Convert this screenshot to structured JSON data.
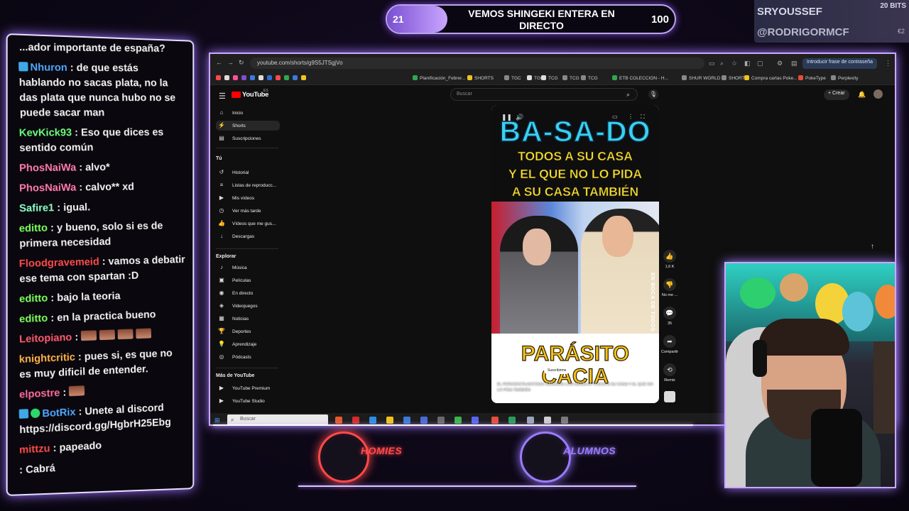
{
  "goal": {
    "start": "21",
    "title": "VEMOS SHINGEKI ENTERA EN DIRECTO",
    "end": "100",
    "progress": 0.21
  },
  "sub_alert": {
    "name": "SRYOUSSEF",
    "bits": "20 BITS",
    "name2": "@RODRIGORMCF",
    "extra": "€2"
  },
  "chat": [
    {
      "user": "",
      "color": "#f1f1f1",
      "text": "...ador importante de españa?",
      "badge": ""
    },
    {
      "user": "Nhuron",
      "color": "#4fa8ff",
      "text": ": de que estás hablando no sacas plata, no la das plata que nunca hubo no se puede sacar man",
      "badge": "blue"
    },
    {
      "user": "KevKick93",
      "color": "#6bff7a",
      "text": ": Eso que dices es sentido común",
      "badge": ""
    },
    {
      "user": "PhosNaiWa",
      "color": "#ff7ab0",
      "text": ": alvo*",
      "badge": ""
    },
    {
      "user": "PhosNaiWa",
      "color": "#ff7ab0",
      "text": ": calvo** xd",
      "badge": ""
    },
    {
      "user": "Safire1",
      "color": "#8fffc6",
      "text": ": igual.",
      "badge": ""
    },
    {
      "user": "editto",
      "color": "#7dff5a",
      "text": ": y bueno, solo si es de primera necesidad",
      "badge": ""
    },
    {
      "user": "Floodgravemeid",
      "color": "#ff4a4a",
      "text": ": vamos a debatir ese tema con spartan :D",
      "badge": ""
    },
    {
      "user": "editto",
      "color": "#7dff5a",
      "text": ": bajo la teoria",
      "badge": ""
    },
    {
      "user": "editto",
      "color": "#7dff5a",
      "text": ": en la practica bueno",
      "badge": ""
    },
    {
      "user": "Leitopiano",
      "color": "#ff5a6e",
      "text": ":",
      "badge": "",
      "emotes": 4
    },
    {
      "user": "knightcritic",
      "color": "#ffb347",
      "text": ": pues si, es que no es muy dificil de entender.",
      "badge": ""
    },
    {
      "user": "elpostre",
      "color": "#ff6b9a",
      "text": ":",
      "badge": "",
      "emotes": 1
    },
    {
      "user": "BotRix",
      "color": "#4fa8ff",
      "text": ": Unete al discord https://discord.gg/HgbrH25Ebg",
      "badge": "blue-green"
    },
    {
      "user": "mittzu",
      "color": "#ff4a4a",
      "text": ": papeado",
      "badge": ""
    },
    {
      "user": "",
      "color": "#f1f1f1",
      "text": ": Cabrá",
      "badge": ""
    }
  ],
  "browser": {
    "url": "youtube.com/shorts/g9S5JTSgjVo",
    "password_hint": "Introducir frase de contraseña",
    "bookmarks": [
      {
        "label": "Planificación_Febrer...",
        "color": "#2fa84f"
      },
      {
        "label": "SHORTS",
        "color": "#f2c31c"
      },
      {
        "label": "TGC",
        "color": "#888888"
      },
      {
        "label": "TGC",
        "color": "#dddddd"
      },
      {
        "label": "TCG",
        "color": "#dddddd"
      },
      {
        "label": "TCG",
        "color": "#888888"
      },
      {
        "label": "TCG",
        "color": "#888888"
      },
      {
        "label": "ETB COLECCION - H...",
        "color": "#2fa84f"
      },
      {
        "label": "SHUR WORLD",
        "color": "#888888"
      },
      {
        "label": "SHORTS",
        "color": "#888888"
      },
      {
        "label": "Compra cartas Poke...",
        "color": "#f2c31c"
      },
      {
        "label": "PokeType",
        "color": "#e74c3c"
      },
      {
        "label": "Perplexity",
        "color": "#888888"
      }
    ]
  },
  "youtube": {
    "logo": "YouTube",
    "logo_cc": "ES",
    "search_placeholder": "Buscar",
    "create_label": "Crear",
    "sidebar_main": [
      {
        "icon": "⌂",
        "label": "Inicio",
        "active": false
      },
      {
        "icon": "⚡",
        "label": "Shorts",
        "active": true
      },
      {
        "icon": "▤",
        "label": "Suscripciones",
        "active": false
      }
    ],
    "you_heading": "Tú",
    "sidebar_you": [
      {
        "icon": "↺",
        "label": "Historial"
      },
      {
        "icon": "≡",
        "label": "Listas de reproducc..."
      },
      {
        "icon": "▶",
        "label": "Mis vídeos"
      },
      {
        "icon": "◷",
        "label": "Ver más tarde"
      },
      {
        "icon": "👍",
        "label": "Vídeos que me gus..."
      },
      {
        "icon": "↓",
        "label": "Descargas"
      }
    ],
    "explore_heading": "Explorar",
    "sidebar_explore": [
      {
        "icon": "♪",
        "label": "Música"
      },
      {
        "icon": "▣",
        "label": "Películas"
      },
      {
        "icon": "◉",
        "label": "En directo"
      },
      {
        "icon": "◈",
        "label": "Videojuegos"
      },
      {
        "icon": "▦",
        "label": "Noticias"
      },
      {
        "icon": "🏆",
        "label": "Deportes"
      },
      {
        "icon": "💡",
        "label": "Aprendizaje"
      },
      {
        "icon": "◎",
        "label": "Pódcasts"
      }
    ],
    "more_heading": "Más de YouTube",
    "sidebar_more": [
      {
        "icon": "▶",
        "label": "YouTube Premium"
      },
      {
        "icon": "▶",
        "label": "YouTube Studio"
      }
    ]
  },
  "short": {
    "headline": "BA-SA-DO",
    "subline1": "TODOS A SU CASA",
    "subline2": "Y EL QUE NO LO PIDA",
    "subline3": "A SU CASA TAMBIÉN",
    "scene_caption": "EN BOCA DE TODOS",
    "tag1": "PARÁSITO",
    "tag2": "CACIA",
    "channel": "@periodistas",
    "subscribe": "Suscribirme",
    "description": "EL PERIODISTA ANTONIO NARANJO LOS MANDA A TODOS A SU CASA Y AL QUE NO LO PIDA TAMBIÉN",
    "actions": [
      {
        "icon": "👍",
        "label": "1,6 K"
      },
      {
        "icon": "👎",
        "label": "No me ..."
      },
      {
        "icon": "💬",
        "label": "35"
      },
      {
        "icon": "➦",
        "label": "Compartir"
      },
      {
        "icon": "⟲",
        "label": "Remix"
      }
    ]
  },
  "taskbar": {
    "search_placeholder": "Buscar"
  },
  "teams": [
    {
      "label": "HOMIES",
      "color": "#ff4a4a"
    },
    {
      "label": "ALUMNOS",
      "color": "#9b7cff"
    }
  ]
}
